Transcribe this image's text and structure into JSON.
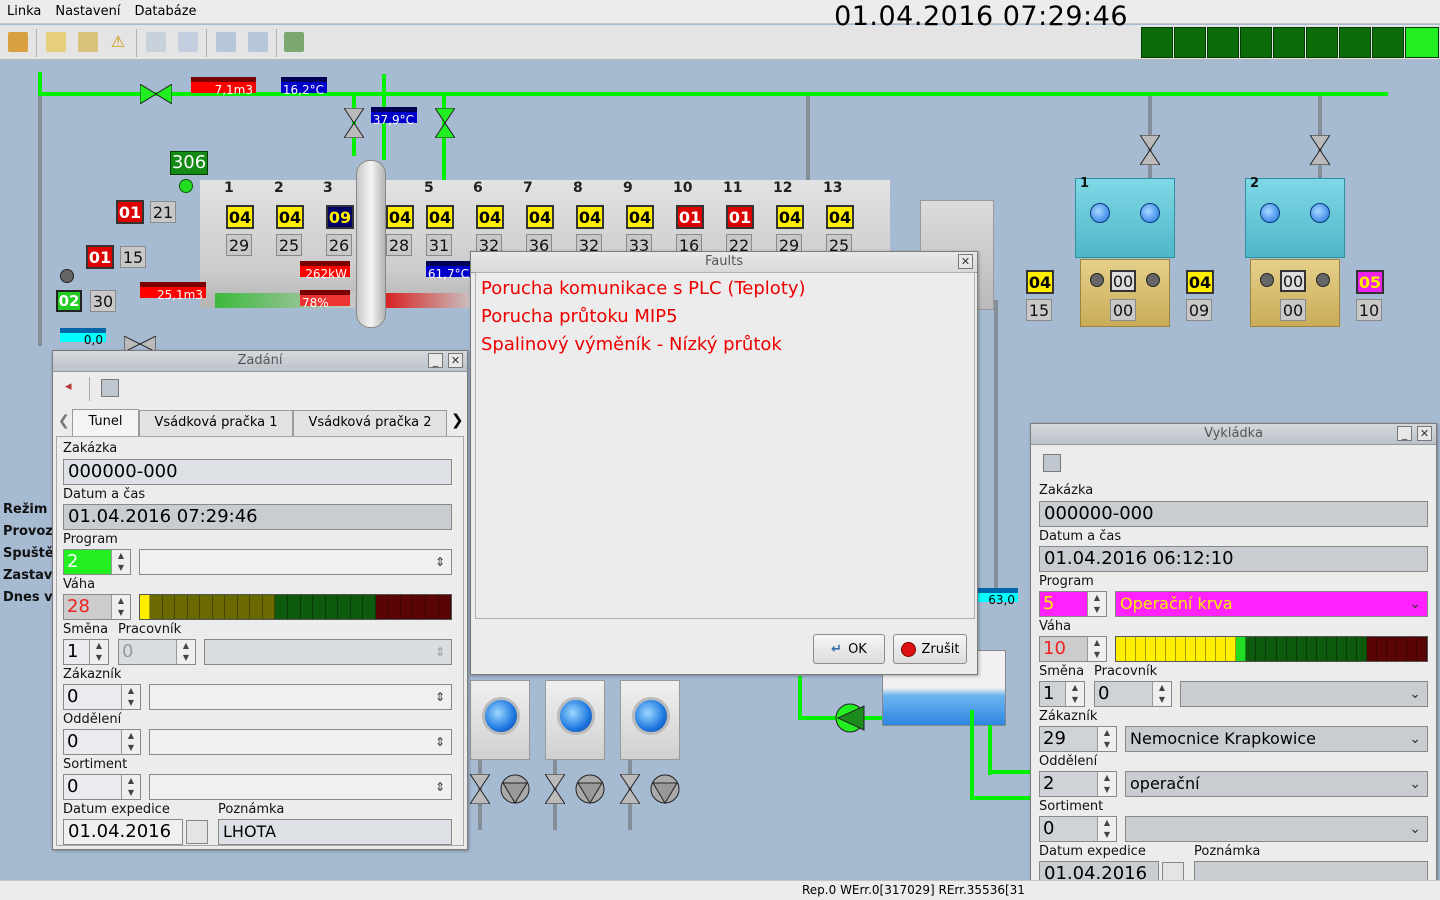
{
  "menu": [
    "Linka",
    "Nastavení",
    "Databáze"
  ],
  "clock": "01.04.2016 07:29:46",
  "status": "Rep.0 WErr.0[317029] RErr.35536[31",
  "scada": {
    "flow_label": "7,1m3",
    "temp_label": "16,2°C",
    "temp2_label": "37,9°C",
    "counter": "306",
    "unit_numbers": [
      "1",
      "2",
      "3",
      "5",
      "6",
      "7",
      "8",
      "9",
      "10",
      "11",
      "12",
      "13"
    ],
    "programs": [
      "04",
      "04",
      "09",
      "04",
      "04",
      "04",
      "04",
      "04",
      "04",
      "01",
      "01",
      "04",
      "04"
    ],
    "values": [
      "29",
      "25",
      "26",
      "28",
      "31",
      "32",
      "36",
      "32",
      "33",
      "16",
      "22",
      "29",
      "25"
    ],
    "power": "262kW",
    "percent": "78%",
    "temp3": "61,7°C",
    "water": "25,1m3",
    "level": "0,0",
    "left_boxes": {
      "a": "01",
      "a_val": "21",
      "b": "01",
      "b_val": "15",
      "c": "02",
      "c_val": "30"
    },
    "right_boxes": {
      "p1": "04",
      "p1v": "15",
      "t1": "00",
      "t1v": "00",
      "p2": "04",
      "p2v": "09",
      "t2": "00",
      "t2v": "00",
      "p3": "05",
      "p3v": "10"
    },
    "tank_labels": [
      "1",
      "2"
    ],
    "cyan2": "63,0"
  },
  "side_labels": [
    "Režim",
    "Provoz",
    "Spuště",
    "Zastav",
    "Dnes v"
  ],
  "faults": {
    "title": "Faults",
    "messages": [
      "Porucha komunikace s PLC (Teploty)",
      "Porucha průtoku MIP5",
      "Spalinový výměník - Nízký průtok"
    ],
    "ok": "OK",
    "cancel": "Zrušit"
  },
  "zadani": {
    "title": "Zadání",
    "tabs": [
      "Tunel",
      "Vsádková pračka 1",
      "Vsádková pračka 2"
    ],
    "l_order": "Zakázka",
    "order": "000000-000",
    "l_datetime": "Datum a čas",
    "datetime": "01.04.2016 07:29:46",
    "l_program": "Program",
    "program": "2",
    "l_weight": "Váha",
    "weight": "28",
    "l_shift": "Směna",
    "shift": "1",
    "l_worker": "Pracovník",
    "worker": "0",
    "l_customer": "Zákazník",
    "customer": "0",
    "l_dept": "Oddělení",
    "dept": "0",
    "l_assort": "Sortiment",
    "assort": "0",
    "l_expdate": "Datum expedice",
    "expdate": "01.04.2016",
    "l_note": "Poznámka",
    "note": "LHOTA"
  },
  "vykladka": {
    "title": "Vykládka",
    "l_order": "Zakázka",
    "order": "000000-000",
    "l_datetime": "Datum a čas",
    "datetime": "01.04.2016 06:12:10",
    "l_program": "Program",
    "program": "5",
    "program_name": "Operační krva",
    "l_weight": "Váha",
    "weight": "10",
    "l_shift": "Směna",
    "shift": "1",
    "l_worker": "Pracovník",
    "worker": "0",
    "l_customer": "Zákazník",
    "customer": "29",
    "customer_name": "Nemocnice Krapkowice",
    "l_dept": "Oddělení",
    "dept": "2",
    "dept_name": "operační",
    "l_assort": "Sortiment",
    "assort": "0",
    "l_expdate": "Datum expedice",
    "expdate": "01.04.2016",
    "l_note": "Poznámka",
    "note": ""
  }
}
